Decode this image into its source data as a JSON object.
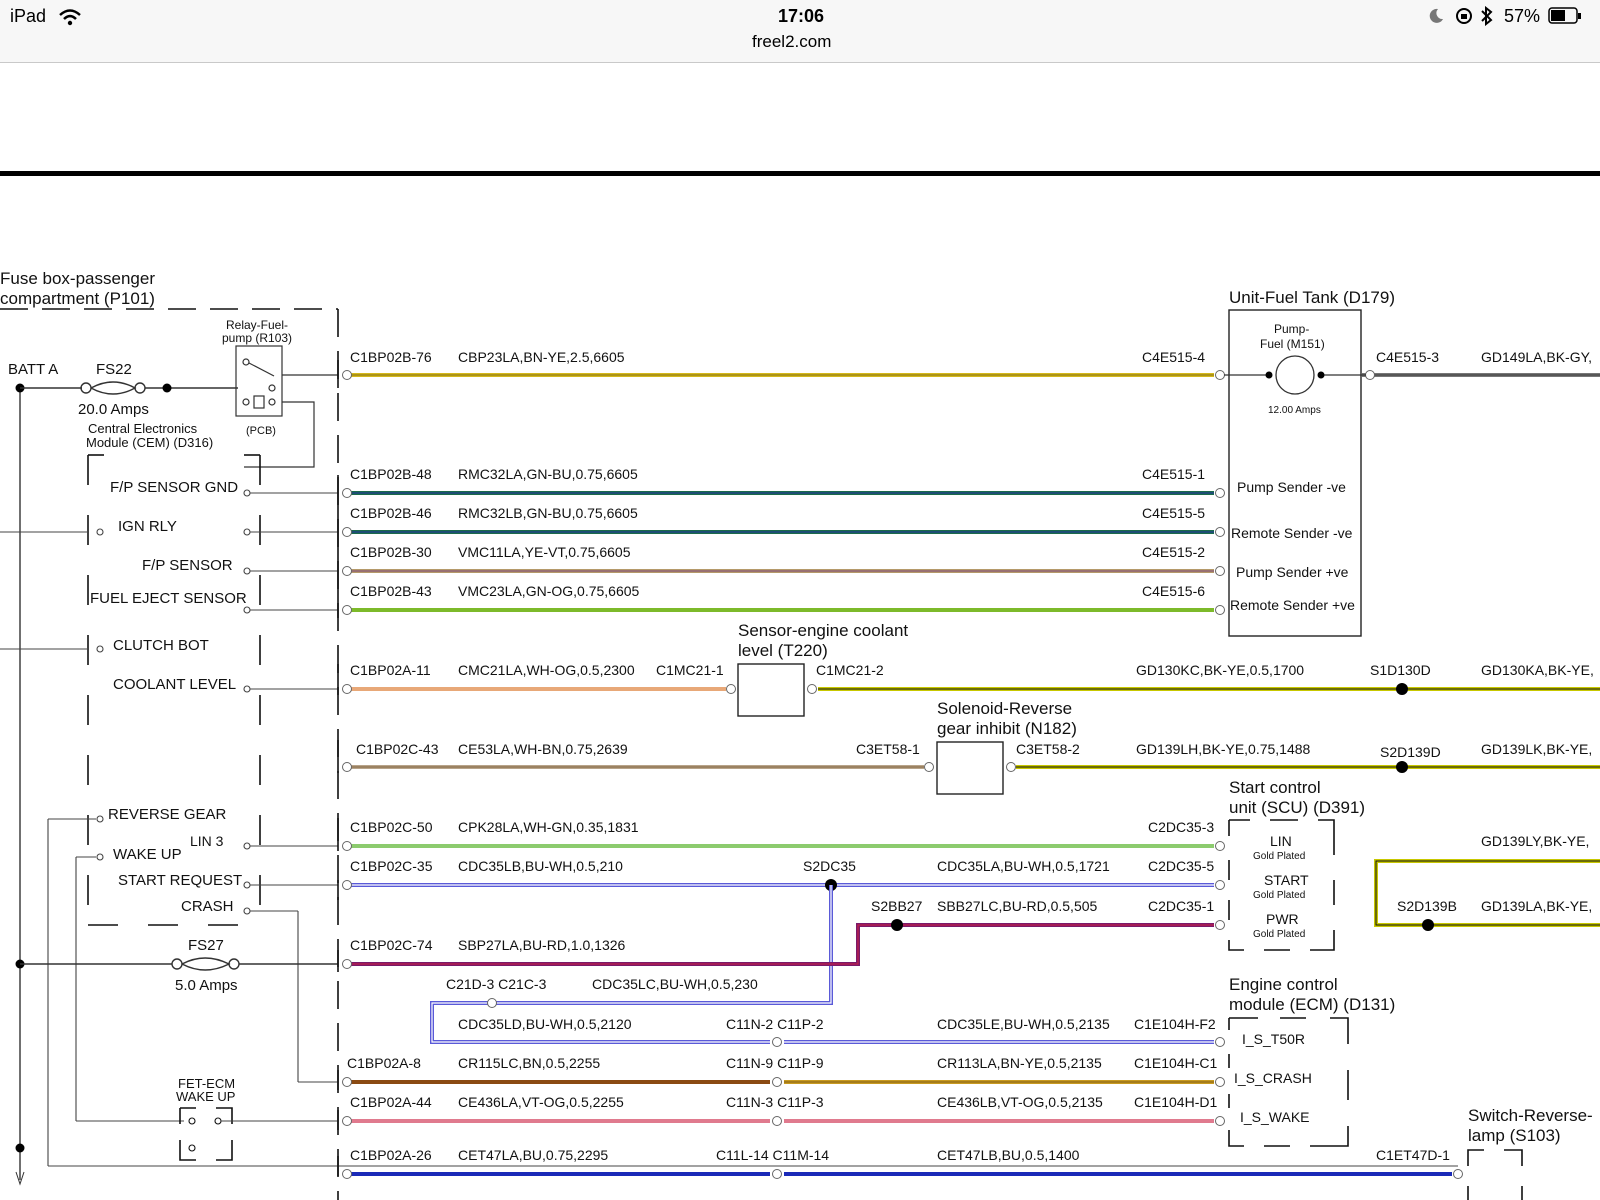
{
  "status_bar": {
    "device": "iPad",
    "time": "17:06",
    "url": "freel2.com",
    "battery": "57%",
    "icons": [
      "wifi-icon",
      "moon-icon",
      "orientation-lock-icon",
      "bluetooth-icon",
      "battery-icon"
    ]
  },
  "left": {
    "fusebox_title_1": "Fuse box-passenger",
    "fusebox_title_2": "compartment (P101)",
    "batt": "BATT A",
    "fs22": "FS22",
    "fs22_amps": "20.0 Amps",
    "relay_1": "Relay-Fuel-",
    "relay_2": "pump (R103)",
    "pcb": "(PCB)",
    "cem_1": "Central Electronics",
    "cem_2": "Module (CEM) (D316)",
    "fp_sensor_gnd": "F/P SENSOR GND",
    "ign_rly": "IGN RLY",
    "fp_sensor": "F/P SENSOR",
    "fuel_eject": "FUEL EJECT SENSOR",
    "clutch_bot": "CLUTCH BOT",
    "coolant_level": "COOLANT LEVEL",
    "reverse_gear": "REVERSE GEAR",
    "lin3": "LIN 3",
    "wake_up": "WAKE UP",
    "start_request": "START REQUEST",
    "crash": "CRASH",
    "fs27": "FS27",
    "fs27_amps": "5.0 Amps",
    "fet_1": "FET-ECM",
    "fet_2": "WAKE UP"
  },
  "components": {
    "fuel_tank_title": "Unit-Fuel Tank (D179)",
    "pump_1": "Pump-",
    "pump_2": "Fuel (M151)",
    "pump_amps": "12.00 Amps",
    "pump_sender_neg": "Pump Sender -ve",
    "remote_sender_neg": "Remote Sender -ve",
    "pump_sender_pos": "Pump Sender +ve",
    "remote_sender_pos": "Remote Sender +ve",
    "coolant_1": "Sensor-engine coolant",
    "coolant_2": "level (T220)",
    "solenoid_1": "Solenoid-Reverse",
    "solenoid_2": "gear inhibit (N182)",
    "scu_1": "Start control",
    "scu_2": "unit (SCU) (D391)",
    "scu_lin": "LIN",
    "scu_start": "START",
    "scu_pwr": "PWR",
    "gold": "Gold Plated",
    "ecm_1": "Engine control",
    "ecm_2": "module (ECM) (D131)",
    "ecm_t50r": "I_S_T50R",
    "ecm_crash": "I_S_CRASH",
    "ecm_wake": "I_S_WAKE",
    "switch_1": "Switch-Reverse-",
    "switch_2": "lamp (S103)"
  },
  "wires": {
    "w1": {
      "from": "C1BP02B-76",
      "code": "CBP23LA,BN-YE,2.5,6605",
      "to": "C4E515-4",
      "out": "C4E515-3",
      "out_code": "GD149LA,BK-GY,",
      "color": "#d4b81e"
    },
    "w2": {
      "from": "C1BP02B-48",
      "code": "RMC32LA,GN-BU,0.75,6605",
      "to": "C4E515-1",
      "color": "#1b6b4a"
    },
    "w3": {
      "from": "C1BP02B-46",
      "code": "RMC32LB,GN-BU,0.75,6605",
      "to": "C4E515-5",
      "color": "#1b6b4a"
    },
    "w4": {
      "from": "C1BP02B-30",
      "code": "VMC11LA,YE-VT,0.75,6605",
      "to": "C4E515-2",
      "color": "#b59a6a"
    },
    "w5": {
      "from": "C1BP02B-43",
      "code": "VMC23LA,GN-OG,0.75,6605",
      "to": "C4E515-6",
      "color": "#7dba2a"
    },
    "w6": {
      "from": "C1BP02A-11",
      "code": "CMC21LA,WH-OG,0.5,2300",
      "to": "C1MC21-1",
      "out": "C1MC21-2",
      "out_code": "GD130KC,BK-YE,0.5,1700",
      "splice": "S1D130D",
      "out_code2": "GD130KA,BK-YE,",
      "color": "#e8a878"
    },
    "w7": {
      "from": "C1BP02C-43",
      "code": "CE53LA,WH-BN,0.75,2639",
      "to": "C3ET58-1",
      "out": "C3ET58-2",
      "out_code": "GD139LH,BK-YE,0.75,1488",
      "splice": "S2D139D",
      "out_code2": "GD139LK,BK-YE,",
      "color": "#b8a48a"
    },
    "w8": {
      "from": "C1BP02C-50",
      "code": "CPK28LA,WH-GN,0.35,1831",
      "to": "C2DC35-3",
      "color": "#8ccb6e"
    },
    "w9": {
      "from": "C1BP02C-35",
      "code": "CDC35LB,BU-WH,0.5,210",
      "splice": "S2DC35",
      "code2": "CDC35LA,BU-WH,0.5,1721",
      "to": "C2DC35-5",
      "color": "#5a5ad8"
    },
    "w10": {
      "splice": "S2BB27",
      "code": "SBB27LC,BU-RD,0.5,505",
      "to": "C2DC35-1",
      "color": "#7a1a6a"
    },
    "w11": {
      "from": "C1BP02C-74",
      "code": "SBP27LA,BU-RD,1.0,1326",
      "color": "#7a1a6a"
    },
    "w12": {
      "conn": "C21D-3 C21C-3",
      "code": "CDC35LC,BU-WH,0.5,230"
    },
    "w13": {
      "code": "CDC35LD,BU-WH,0.5,2120",
      "conn": "C11N-2 C11P-2",
      "code2": "CDC35LE,BU-WH,0.5,2135",
      "to": "C1E104H-F2"
    },
    "w14": {
      "from": "C1BP02A-8",
      "code": "CR115LC,BN,0.5,2255",
      "conn": "C11N-9 C11P-9",
      "code2": "CR113LA,BN-YE,0.5,2135",
      "to": "C1E104H-C1",
      "color": "#8a4a12"
    },
    "w15": {
      "from": "C1BP02A-44",
      "code": "CE436LA,VT-OG,0.5,2255",
      "conn": "C11N-3 C11P-3",
      "code2": "CE436LB,VT-OG,0.5,2135",
      "to": "C1E104H-D1",
      "color": "#e07a8e"
    },
    "w16": {
      "from": "C1BP02A-26",
      "code": "CET47LA,BU,0.75,2295",
      "conn": "C11L-14 C11M-14",
      "code2": "CET47LB,BU,0.5,1400",
      "to": "C1ET47D-1",
      "color": "#1a2ab8"
    },
    "r1": {
      "code": "GD139LY,BK-YE,"
    },
    "r2": {
      "splice": "S2D139B",
      "code": "GD139LA,BK-YE,"
    }
  }
}
